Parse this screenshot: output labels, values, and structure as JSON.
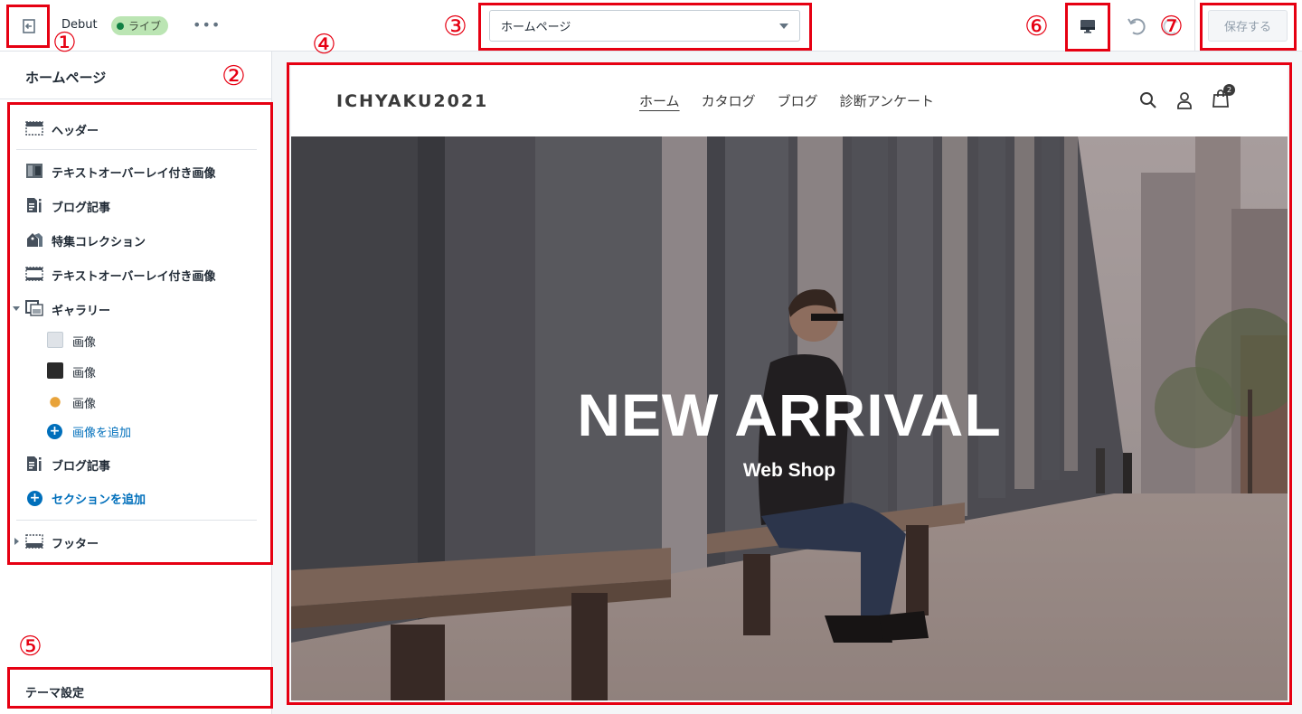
{
  "topbar": {
    "theme_name": "Debut",
    "live_label": "ライブ",
    "more_label": "•••",
    "page_select_value": "ホームページ",
    "save_label": "保存する"
  },
  "sidebar": {
    "title": "ホームページ",
    "sections": [
      {
        "label": "ヘッダー",
        "icon": "header-layout-icon"
      },
      {
        "label": "テキストオーバーレイ付き画像",
        "icon": "image-thumbnail-icon"
      },
      {
        "label": "ブログ記事",
        "icon": "blog-posts-icon"
      },
      {
        "label": "特集コレクション",
        "icon": "collection-tag-icon"
      },
      {
        "label": "テキストオーバーレイ付き画像",
        "icon": "dashed-layout-icon"
      },
      {
        "label": "ギャラリー",
        "icon": "gallery-icon"
      }
    ],
    "gallery_items": [
      {
        "label": "画像"
      },
      {
        "label": "画像"
      },
      {
        "label": "画像"
      }
    ],
    "add_image_label": "画像を追加",
    "blog_posts_label": "ブログ記事",
    "add_section_label": "セクションを追加",
    "footer_label": "フッター",
    "theme_settings_label": "テーマ設定"
  },
  "preview": {
    "logo": "ICHYAKU2021",
    "nav": [
      "ホーム",
      "カタログ",
      "ブログ",
      "診断アンケート"
    ],
    "cart_count": "2",
    "hero_title": "NEW ARRIVAL",
    "hero_subtitle": "Web Shop"
  },
  "annotations": [
    "①",
    "②",
    "③",
    "④",
    "⑤",
    "⑥",
    "⑦"
  ],
  "colors": {
    "annotation_red": "#e60012",
    "link_blue": "#006fbb",
    "live_green": "#bbe5b3"
  }
}
